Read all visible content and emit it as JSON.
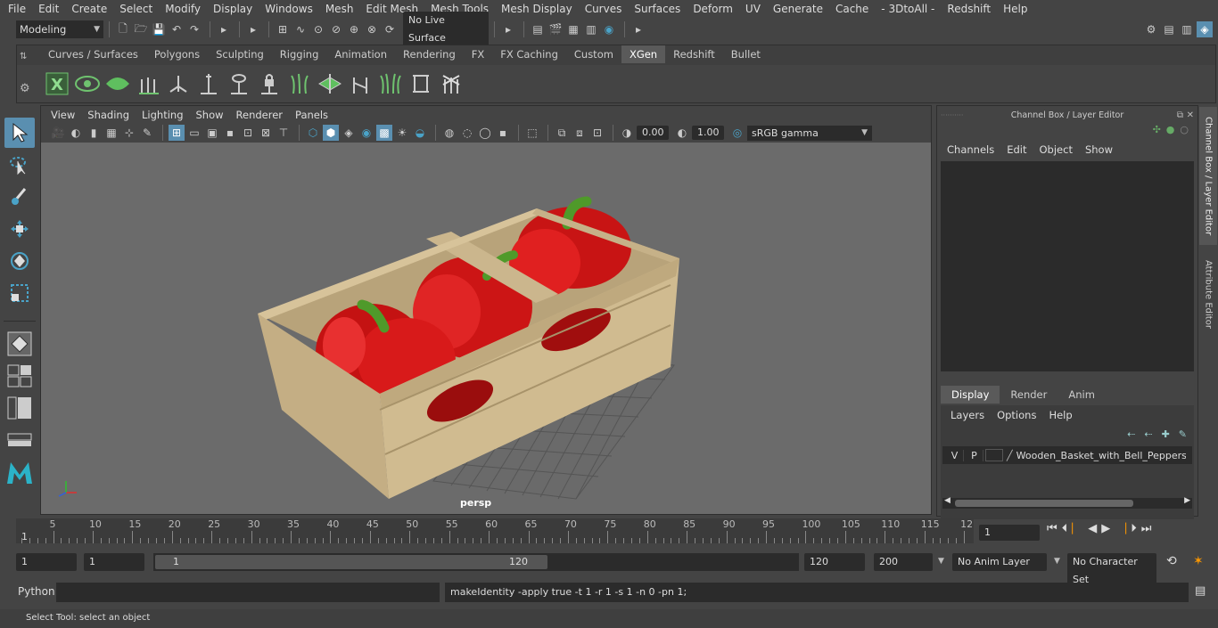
{
  "menubar": [
    "File",
    "Edit",
    "Create",
    "Select",
    "Modify",
    "Display",
    "Windows",
    "Mesh",
    "Edit Mesh",
    "Mesh Tools",
    "Mesh Display",
    "Curves",
    "Surfaces",
    "Deform",
    "UV",
    "Generate",
    "Cache",
    "- 3DtoAll -",
    "Redshift",
    "Help"
  ],
  "statusline": {
    "mode": "Modeling",
    "live_surface": "No Live Surface"
  },
  "shelf_tabs": [
    "Curves / Surfaces",
    "Polygons",
    "Sculpting",
    "Rigging",
    "Animation",
    "Rendering",
    "FX",
    "FX Caching",
    "Custom",
    "XGen",
    "Redshift",
    "Bullet"
  ],
  "active_shelf_tab": "XGen",
  "viewport": {
    "menus": [
      "View",
      "Shading",
      "Lighting",
      "Show",
      "Renderer",
      "Panels"
    ],
    "exposure": "0.00",
    "gamma": "1.00",
    "color_space": "sRGB gamma",
    "camera_label": "persp"
  },
  "channel_box": {
    "title": "Channel Box / Layer Editor",
    "menus": [
      "Channels",
      "Edit",
      "Object",
      "Show"
    ],
    "side_tabs": [
      "Channel Box / Layer Editor",
      "Attribute Editor"
    ]
  },
  "layer_editor": {
    "tabs": [
      "Display",
      "Render",
      "Anim"
    ],
    "active_tab": "Display",
    "menus": [
      "Layers",
      "Options",
      "Help"
    ],
    "layer": {
      "v": "V",
      "p": "P",
      "name": "Wooden_Basket_with_Bell_Peppers_C"
    }
  },
  "timeline": {
    "ticks": [
      "5",
      "10",
      "15",
      "20",
      "25",
      "30",
      "35",
      "40",
      "45",
      "50",
      "55",
      "60",
      "65",
      "70",
      "75",
      "80",
      "85",
      "90",
      "95",
      "100",
      "105",
      "110",
      "115",
      "12"
    ],
    "start_label": "1",
    "current_frame": "1"
  },
  "range": {
    "start": "1",
    "playback_start": "1",
    "slider_min": "1",
    "slider_max": "120",
    "playback_end": "120",
    "end": "200",
    "anim_layer": "No Anim Layer",
    "character_set": "No Character Set"
  },
  "command": {
    "lang": "Python",
    "result": "makeIdentity -apply true -t 1 -r 1 -s 1 -n 0 -pn 1;"
  },
  "help_line": "Select Tool: select an object",
  "colors": {
    "accent": "#4aa3c8",
    "xgen_green": "#5fbf5f",
    "pepper_red": "#d41a1a",
    "crate": "#c9b58c"
  }
}
